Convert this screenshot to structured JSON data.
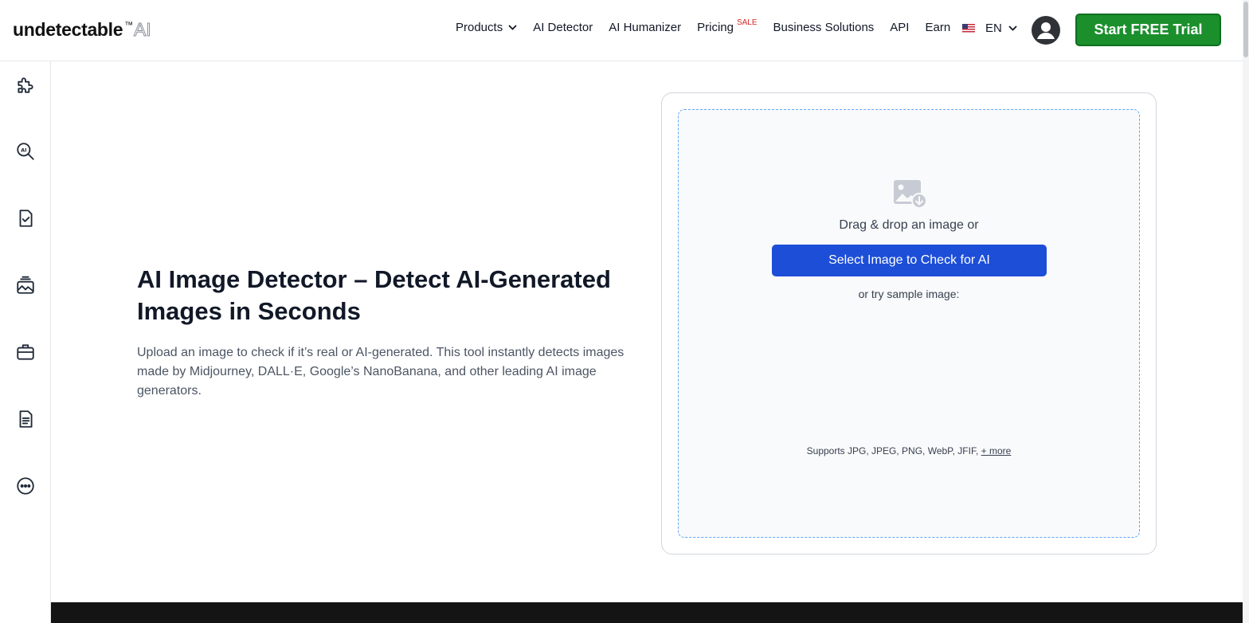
{
  "header": {
    "logo": {
      "brand": "undetectable",
      "tm": "™",
      "suffix": "AI"
    },
    "nav": [
      {
        "label": "Products",
        "has_dropdown": true
      },
      {
        "label": "AI Detector"
      },
      {
        "label": "AI Humanizer"
      },
      {
        "label": "Pricing",
        "badge": "SALE"
      },
      {
        "label": "Business Solutions"
      },
      {
        "label": "API"
      },
      {
        "label": "Earn"
      }
    ],
    "language": {
      "code": "EN",
      "flag": "us-flag-icon"
    },
    "account_icon": "user-avatar-icon",
    "cta_label": "Start FREE Trial"
  },
  "sidebar": {
    "items": [
      {
        "icon": "puzzle-icon"
      },
      {
        "icon": "ai-search-icon"
      },
      {
        "icon": "document-check-icon"
      },
      {
        "icon": "image-stack-icon"
      },
      {
        "icon": "briefcase-icon"
      },
      {
        "icon": "document-text-icon"
      },
      {
        "icon": "more-icon"
      }
    ]
  },
  "hero": {
    "title": "AI Image Detector – Detect AI-Generated Images in Seconds",
    "description": "Upload an image to check if it’s real or AI-generated. This tool instantly detects images made by Midjourney, DALL·E, Google’s NanoBanana, and other leading AI image generators."
  },
  "upload": {
    "drag_text": "Drag & drop an image or",
    "button_label": "Select Image to Check for AI",
    "sample_text": "or try sample image:",
    "supports_text": "Supports JPG, JPEG, PNG, WebP, JFIF,",
    "more_link": "+ more"
  },
  "colors": {
    "cta_green": "#1a8f2c",
    "primary_blue": "#1d4ed8",
    "sale_red": "#dc2626",
    "dropzone_border": "#60a5fa"
  }
}
